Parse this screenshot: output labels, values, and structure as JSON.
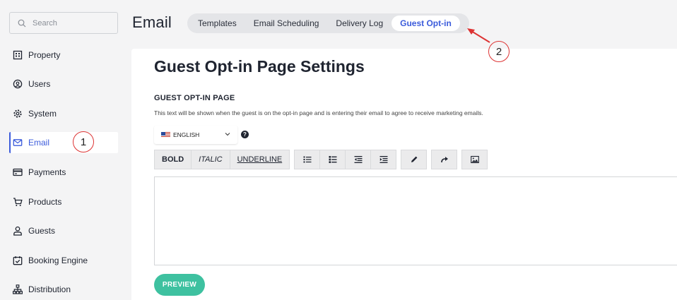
{
  "sidebar": {
    "search_placeholder": "Search",
    "items": [
      {
        "label": "Property",
        "icon": "building-icon"
      },
      {
        "label": "Users",
        "icon": "user-circle-icon"
      },
      {
        "label": "System",
        "icon": "gear-icon"
      },
      {
        "label": "Email",
        "icon": "envelope-icon",
        "active": true
      },
      {
        "label": "Payments",
        "icon": "card-icon"
      },
      {
        "label": "Products",
        "icon": "cart-icon"
      },
      {
        "label": "Guests",
        "icon": "person-icon"
      },
      {
        "label": "Booking Engine",
        "icon": "calendar-check-icon"
      },
      {
        "label": "Distribution",
        "icon": "sitemap-icon"
      }
    ]
  },
  "header": {
    "title": "Email",
    "tabs": [
      {
        "label": "Templates"
      },
      {
        "label": "Email Scheduling"
      },
      {
        "label": "Delivery Log"
      },
      {
        "label": "Guest Opt-in",
        "active": true
      }
    ]
  },
  "annotations": {
    "badge_1": "1",
    "badge_2": "2"
  },
  "main": {
    "page_title": "Guest Opt-in Page Settings",
    "section_title": "GUEST OPT-IN PAGE",
    "help_text": "This text will be shown when the guest is on the opt-in page and is entering their email to agree to receive marketing emails.",
    "language": {
      "selected": "ENGLISH"
    },
    "help_icon": "?",
    "toolbar": {
      "bold": "BOLD",
      "italic": "ITALIC",
      "underline": "UNDERLINE"
    },
    "preview_label": "PREVIEW"
  },
  "colors": {
    "accent": "#3b5bdb",
    "preview_button": "#3ec1a0",
    "annotation": "#dd3333"
  }
}
